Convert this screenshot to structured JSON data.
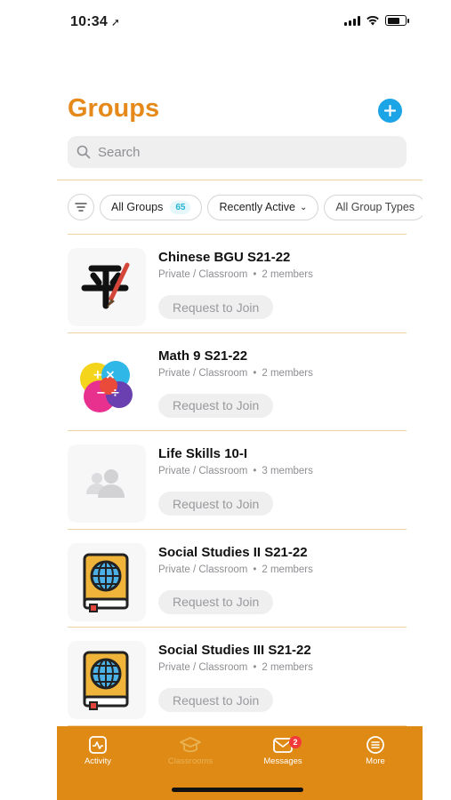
{
  "status": {
    "time": "10:34",
    "location_icon": "location-arrow-icon"
  },
  "header": {
    "title": "Groups",
    "add_icon": "plus-icon"
  },
  "search": {
    "placeholder": "Search"
  },
  "filters": {
    "icon": "filter-icon",
    "chips": [
      {
        "label": "All Groups",
        "count": "65"
      },
      {
        "label": "Recently Active"
      },
      {
        "label": "All Group Types"
      }
    ]
  },
  "groups": [
    {
      "name": "Chinese BGU S21-22",
      "privacy": "Private / Classroom",
      "members": "2 members",
      "action": "Request to Join",
      "thumb": "chinese-calligraphy-icon"
    },
    {
      "name": "Math 9 S21-22",
      "privacy": "Private / Classroom",
      "members": "2 members",
      "action": "Request to Join",
      "thumb": "math-splash-icon"
    },
    {
      "name": "Life Skills 10-I",
      "privacy": "Private / Classroom",
      "members": "3 members",
      "action": "Request to Join",
      "thumb": "people-placeholder-icon"
    },
    {
      "name": "Social Studies II S21-22",
      "privacy": "Private / Classroom",
      "members": "2 members",
      "action": "Request to Join",
      "thumb": "globe-book-icon"
    },
    {
      "name": "Social Studies III S21-22",
      "privacy": "Private / Classroom",
      "members": "2 members",
      "action": "Request to Join",
      "thumb": "globe-book-icon"
    }
  ],
  "tabs": [
    {
      "label": "Activity",
      "icon": "activity-icon"
    },
    {
      "label": "Classrooms",
      "icon": "classroom-icon",
      "active": true
    },
    {
      "label": "Messages",
      "icon": "messages-icon",
      "badge": "2"
    },
    {
      "label": "More",
      "icon": "more-icon"
    }
  ],
  "colors": {
    "accent": "#e5891b",
    "add_button": "#1ba4e6",
    "tabbar": "#df8a15",
    "badge": "#f23a3a"
  }
}
